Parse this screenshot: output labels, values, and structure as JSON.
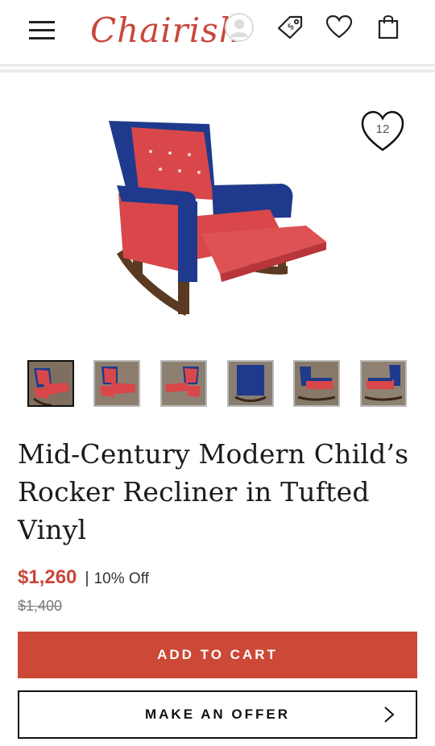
{
  "header": {
    "logo": "Chairish",
    "icons": [
      "menu-icon",
      "account-icon",
      "sell-tag-icon",
      "favorites-heart-icon",
      "shopping-bag-icon"
    ]
  },
  "product": {
    "favorite_count": "12",
    "title": "Mid-Century Modern Child’s Rocker Recliner in Tufted Vinyl",
    "price": "$1,260",
    "price_separator": "|",
    "discount": "10% Off",
    "original_price": "$1,400",
    "thumbnail_count": 6
  },
  "actions": {
    "add_to_cart": "ADD TO CART",
    "make_offer": "MAKE AN OFFER"
  },
  "colors": {
    "brand_red": "#c8463a",
    "button_red": "#cc4837",
    "chair_blue": "#1f3a8c",
    "chair_red": "#d9474a"
  }
}
